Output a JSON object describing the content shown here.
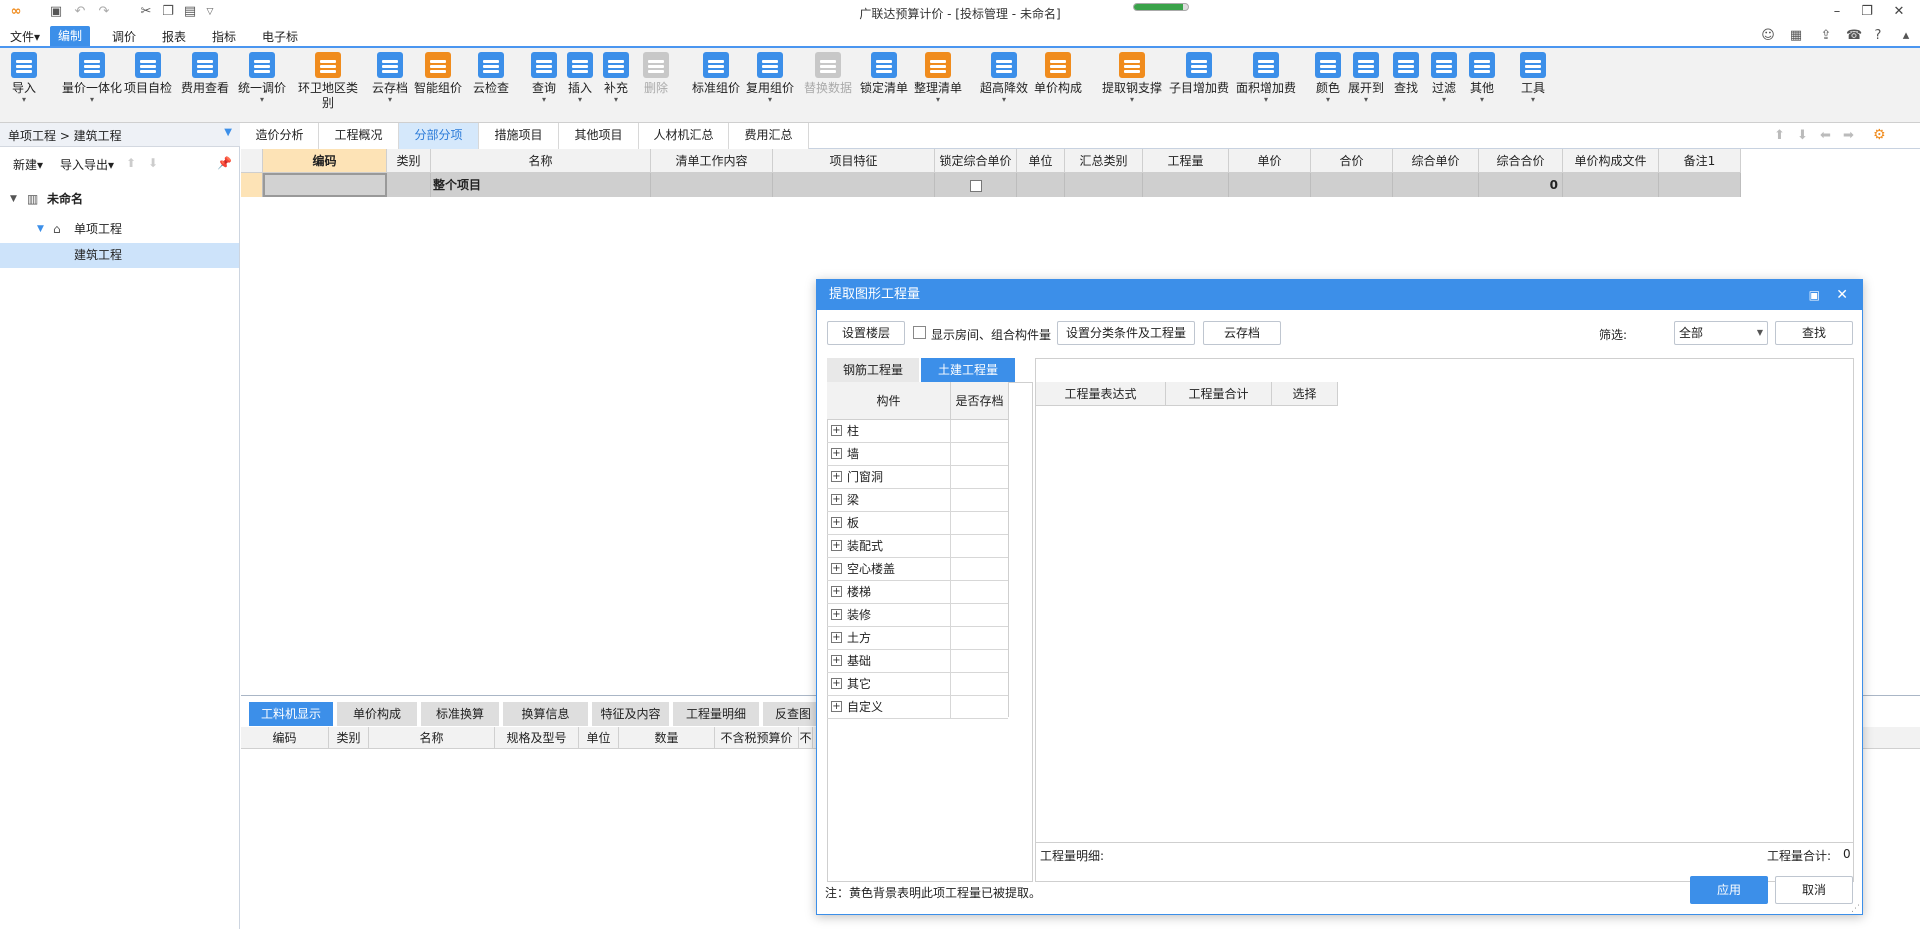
{
  "window": {
    "title": "广联达预算计价 - [投标管理 - 未命名]",
    "progress": 0.9
  },
  "menu": {
    "items": [
      "文件▾",
      "编制",
      "调价",
      "报表",
      "指标",
      "电子标"
    ],
    "active_index": 1
  },
  "ribbon": {
    "buttons": [
      {
        "label": "导入",
        "dd": "▾",
        "color": "#3c8fe9",
        "icon": "import-icon"
      },
      {
        "label": "量价一体化",
        "dd": "▾",
        "color": "#3c8fe9",
        "icon": "integration-icon"
      },
      {
        "label": "项目自检",
        "dd": "",
        "color": "#3c8fe9",
        "icon": "self-check-icon"
      },
      {
        "label": "费用查看",
        "dd": "",
        "color": "#3c8fe9",
        "icon": "fee-view-icon"
      },
      {
        "label": "统一调价",
        "dd": "▾",
        "color": "#3c8fe9",
        "icon": "adjust-price-icon"
      },
      {
        "label": "环卫地区类别",
        "dd": "",
        "color": "#f08c1e",
        "icon": "region-icon"
      },
      {
        "label": "云存档",
        "dd": "▾",
        "color": "#3c8fe9",
        "icon": "cloud-save-icon"
      },
      {
        "label": "智能组价",
        "dd": "",
        "color": "#f08c1e",
        "icon": "smart-pricing-icon"
      },
      {
        "label": "云检查",
        "dd": "",
        "color": "#3c8fe9",
        "icon": "cloud-check-icon"
      },
      {
        "label": "查询",
        "dd": "▾",
        "color": "#3c8fe9",
        "icon": "query-icon"
      },
      {
        "label": "插入",
        "dd": "▾",
        "color": "#3c8fe9",
        "icon": "insert-icon"
      },
      {
        "label": "补充",
        "dd": "▾",
        "color": "#3c8fe9",
        "icon": "supplement-icon"
      },
      {
        "label": "删除",
        "dd": "",
        "color": "#c8c8c8",
        "icon": "delete-icon",
        "disabled": true
      },
      {
        "label": "标准组价",
        "dd": "",
        "color": "#3c8fe9",
        "icon": "standard-pricing-icon"
      },
      {
        "label": "复用组价",
        "dd": "▾",
        "color": "#3c8fe9",
        "icon": "reuse-pricing-icon"
      },
      {
        "label": "替换数据",
        "dd": "",
        "color": "#c8c8c8",
        "icon": "replace-data-icon",
        "disabled": true
      },
      {
        "label": "锁定清单",
        "dd": "",
        "color": "#3c8fe9",
        "icon": "lock-icon"
      },
      {
        "label": "整理清单",
        "dd": "▾",
        "color": "#f08c1e",
        "icon": "organize-list-icon"
      },
      {
        "label": "超高降效",
        "dd": "▾",
        "color": "#3c8fe9",
        "icon": "high-rise-icon"
      },
      {
        "label": "单价构成",
        "dd": "",
        "color": "#f08c1e",
        "icon": "unit-price-icon"
      },
      {
        "label": "提取钢支撑",
        "dd": "▾",
        "color": "#f08c1e",
        "icon": "steel-support-icon"
      },
      {
        "label": "子目增加费",
        "dd": "",
        "color": "#3c8fe9",
        "icon": "sub-item-fee-icon"
      },
      {
        "label": "面积增加费",
        "dd": "▾",
        "color": "#3c8fe9",
        "icon": "area-fee-icon"
      },
      {
        "label": "颜色",
        "dd": "▾",
        "color": "#3c8fe9",
        "icon": "color-icon"
      },
      {
        "label": "展开到",
        "dd": "▾",
        "color": "#3c8fe9",
        "icon": "expand-icon"
      },
      {
        "label": "查找",
        "dd": "",
        "color": "#3c8fe9",
        "icon": "find-icon"
      },
      {
        "label": "过滤",
        "dd": "▾",
        "color": "#3c8fe9",
        "icon": "filter-icon"
      },
      {
        "label": "其他",
        "dd": "▾",
        "color": "#3c8fe9",
        "icon": "other-icon"
      },
      {
        "label": "工具",
        "dd": "▾",
        "color": "#3c8fe9",
        "icon": "tools-icon"
      }
    ]
  },
  "left": {
    "breadcrumb": "单项工程 > 建筑工程",
    "new_label": "新建▾",
    "io_label": "导入导出▾",
    "tree": [
      {
        "label": "未命名",
        "level": 0
      },
      {
        "label": "单项工程",
        "level": 1
      },
      {
        "label": "建筑工程",
        "level": 2,
        "selected": true
      }
    ]
  },
  "tabs": [
    "造价分析",
    "工程概况",
    "分部分项",
    "措施项目",
    "其他项目",
    "人材机汇总",
    "费用汇总"
  ],
  "tabs_active": 2,
  "grid": {
    "headers": [
      "",
      "编码",
      "类别",
      "名称",
      "清单工作内容",
      "项目特征",
      "锁定综合单价",
      "单位",
      "汇总类别",
      "工程量",
      "单价",
      "合价",
      "综合单价",
      "综合合价",
      "单价构成文件",
      "备注1"
    ],
    "row": {
      "name": "整个项目",
      "total": "0"
    }
  },
  "bottom": {
    "tabs": [
      "工料机显示",
      "单价构成",
      "标准换算",
      "换算信息",
      "特征及内容",
      "工程量明细",
      "反查图"
    ],
    "headers": [
      "编码",
      "类别",
      "名称",
      "规格及型号",
      "单位",
      "数量",
      "不含税预算价",
      "不"
    ]
  },
  "dialog": {
    "title": "提取图形工程量",
    "set_floor": "设置楼层",
    "show_rooms": "显示房间、组合构件量",
    "set_conditions": "设置分类条件及工程量",
    "cloud_save": "云存档",
    "filter_label": "筛选:",
    "filter_value": "全部",
    "find": "查找",
    "tab_rebar": "钢筋工程量",
    "tab_civil": "土建工程量",
    "comp_headers": [
      "构件",
      "是否存档"
    ],
    "components": [
      "柱",
      "墙",
      "门窗洞",
      "梁",
      "板",
      "装配式",
      "空心楼盖",
      "楼梯",
      "装修",
      "土方",
      "基础",
      "其它",
      "自定义"
    ],
    "qty_headers": [
      "工程量表达式",
      "工程量合计",
      "选择"
    ],
    "detail_label": "工程量明细:",
    "total_label": "工程量合计:",
    "total_value": "0",
    "note": "注：黄色背景表明此项工程量已被提取。",
    "apply": "应用",
    "cancel": "取消"
  }
}
